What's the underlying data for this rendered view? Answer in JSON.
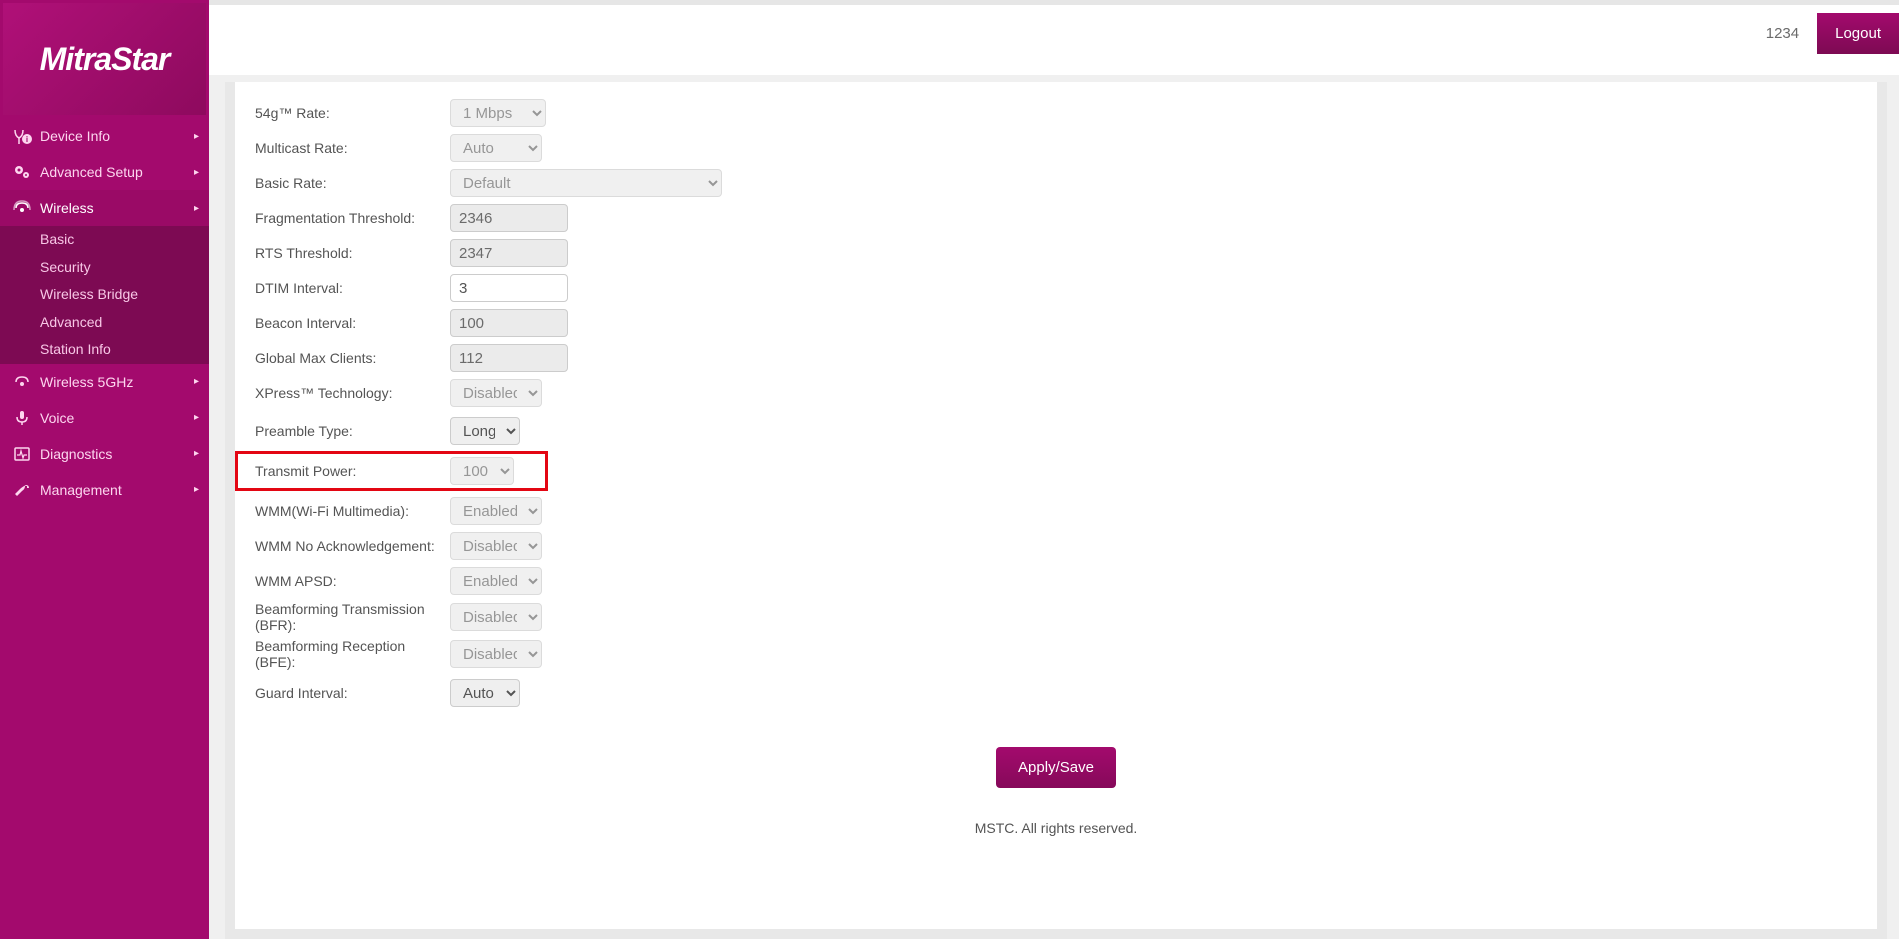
{
  "brand": "MitraStar",
  "user_id": "1234",
  "logout": "Logout",
  "nav": {
    "device_info": "Device Info",
    "advanced_setup": "Advanced Setup",
    "wireless": "Wireless",
    "wireless_sub": {
      "basic": "Basic",
      "security": "Security",
      "wireless_bridge": "Wireless Bridge",
      "advanced": "Advanced",
      "station_info": "Station Info"
    },
    "wireless_5g": "Wireless 5GHz",
    "voice": "Voice",
    "diagnostics": "Diagnostics",
    "management": "Management"
  },
  "form": {
    "rate_54g": {
      "label": "54g™ Rate:",
      "value": "1 Mbps"
    },
    "multicast_rate": {
      "label": "Multicast Rate:",
      "value": "Auto"
    },
    "basic_rate": {
      "label": "Basic Rate:",
      "value": "Default"
    },
    "frag_threshold": {
      "label": "Fragmentation Threshold:",
      "value": "2346"
    },
    "rts_threshold": {
      "label": "RTS Threshold:",
      "value": "2347"
    },
    "dtim_interval": {
      "label": "DTIM Interval:",
      "value": "3"
    },
    "beacon_interval": {
      "label": "Beacon Interval:",
      "value": "100"
    },
    "global_max_clients": {
      "label": "Global Max Clients:",
      "value": "112"
    },
    "xpress": {
      "label": "XPress™ Technology:",
      "value": "Disabled"
    },
    "preamble": {
      "label": "Preamble Type:",
      "value": "Long"
    },
    "transmit_power": {
      "label": "Transmit Power:",
      "value": "100"
    },
    "wmm": {
      "label": "WMM(Wi-Fi Multimedia):",
      "value": "Enabled"
    },
    "wmm_noack": {
      "label": "WMM No Acknowledgement:",
      "value": "Disabled"
    },
    "wmm_apsd": {
      "label": "WMM APSD:",
      "value": "Enabled"
    },
    "bfr": {
      "label": "Beamforming Transmission (BFR):",
      "value": "Disabled"
    },
    "bfe": {
      "label": "Beamforming Reception (BFE):",
      "value": "Disabled"
    },
    "guard_interval": {
      "label": "Guard Interval:",
      "value": "Auto"
    }
  },
  "apply_save": "Apply/Save",
  "footer": "MSTC. All rights reserved."
}
